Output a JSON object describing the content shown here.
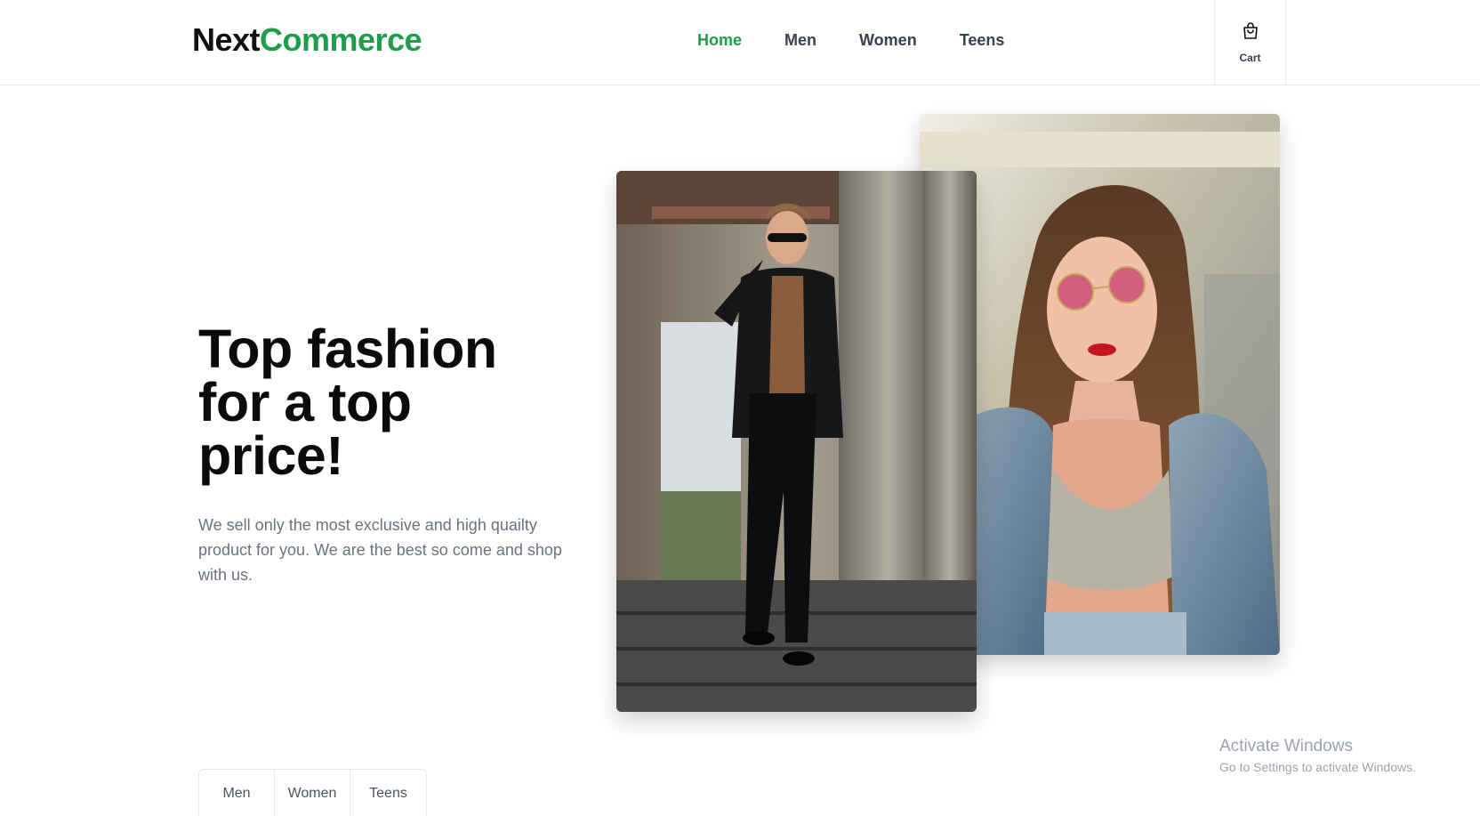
{
  "brand": {
    "part1": "Next",
    "part2": "Commerce"
  },
  "nav": {
    "items": [
      {
        "label": "Home",
        "active": true
      },
      {
        "label": "Men",
        "active": false
      },
      {
        "label": "Women",
        "active": false
      },
      {
        "label": "Teens",
        "active": false
      }
    ]
  },
  "cart": {
    "label": "Cart",
    "icon": "shopping-bag-icon"
  },
  "hero": {
    "title": "Top fashion for a top price!",
    "description": "We sell only the most exclusive and high quailty product for you. We are the best so come and shop with us."
  },
  "images": {
    "man": "man-in-black-suit-photo",
    "woman": "woman-in-sunglasses-photo"
  },
  "tabs": [
    "Men",
    "Women",
    "Teens"
  ],
  "watermark": {
    "title": "Activate Windows",
    "subtitle": "Go to Settings to activate Windows."
  },
  "colors": {
    "accent": "#1f9d4c",
    "text": "#111111",
    "muted": "#6b7280",
    "border": "#e5e7eb"
  }
}
